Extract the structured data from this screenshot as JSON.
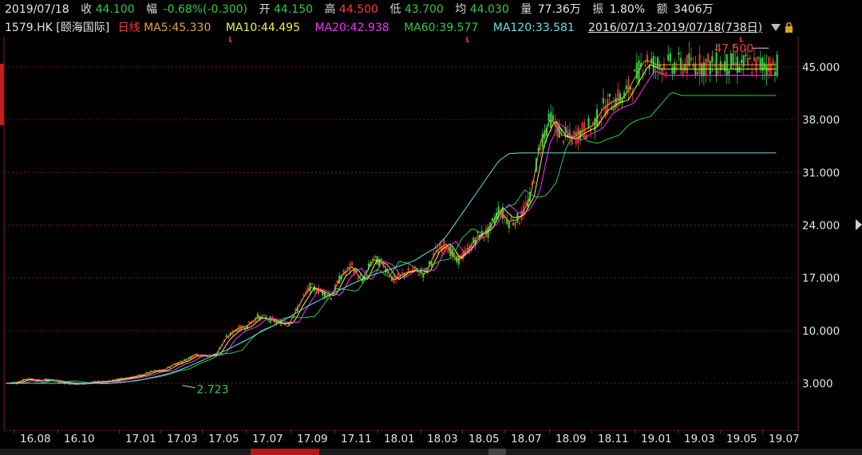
{
  "quote": {
    "date": "2019/07/18",
    "close_label": "收",
    "close": "44.100",
    "change_label": "幅",
    "change": "-0.68%(-0.300)",
    "open_label": "开",
    "open": "44.150",
    "high_label": "高",
    "high": "44.500",
    "low_label": "低",
    "low": "43.700",
    "avg_label": "均",
    "avg": "44.030",
    "volume_label": "量",
    "volume": "77.36万",
    "amplitude_label": "振",
    "amplitude": "1.80%",
    "amount_label": "额",
    "amount": "3406万"
  },
  "info": {
    "code": "1579.HK [颐海国际]",
    "period": "日线",
    "ma5": "MA5:45.330",
    "ma10": "MA10:44.495",
    "ma20": "MA20:42.938",
    "ma60": "MA60:39.577",
    "ma120": "MA120:33.581",
    "range": "2016/07/13-2019/07/18(738日)"
  },
  "colors": {
    "ma5": "#e8a23a",
    "ma10": "#f2f24a",
    "ma20": "#ff2bff",
    "ma60": "#2ecc40",
    "ma120": "#5fe3ea",
    "up": "#ff3b30",
    "down": "#2ecc40",
    "grid": "#7a1a1a"
  },
  "chart_data": {
    "type": "line",
    "title": "1579.HK 颐海国际 日线",
    "ylim": [
      0,
      49
    ],
    "y_ticks": [
      "45.000",
      "38.000",
      "31.000",
      "24.000",
      "17.000",
      "10.000",
      "3.000"
    ],
    "x_ticks": [
      "16.08",
      "16.10",
      "17.01",
      "17.03",
      "17.05",
      "17.07",
      "17.09",
      "17.11",
      "18.01",
      "18.03",
      "18.05",
      "18.07",
      "18.09",
      "18.11",
      "19.01",
      "19.03",
      "19.05",
      "19.07"
    ],
    "annotations": [
      {
        "text": "47.500",
        "type": "max"
      },
      {
        "text": "2.723",
        "type": "min"
      }
    ],
    "x": [
      0,
      10,
      20,
      30,
      40,
      50,
      60,
      70,
      80,
      90,
      100,
      110,
      120,
      130,
      140,
      150,
      160,
      170,
      180,
      190,
      200,
      210,
      220,
      230,
      240,
      250,
      260,
      270,
      280,
      290,
      300,
      310,
      320,
      330,
      340,
      350,
      360,
      370,
      380,
      390,
      400,
      410,
      420,
      430,
      440,
      450,
      460,
      470,
      480,
      490,
      500,
      510,
      520,
      530,
      540,
      550,
      560,
      570,
      580,
      590,
      600,
      610,
      620,
      630,
      640,
      650,
      660,
      670,
      680,
      690,
      700,
      710,
      720,
      730,
      737
    ],
    "series": [
      {
        "name": "MA5",
        "values": [
          3.0,
          3.1,
          3.6,
          3.3,
          3.5,
          3.2,
          3.0,
          2.9,
          3.1,
          3.2,
          3.3,
          3.6,
          3.8,
          4.1,
          4.6,
          4.7,
          5.5,
          6.0,
          6.8,
          6.6,
          6.8,
          9.0,
          10.2,
          10.6,
          11.8,
          11.6,
          11.0,
          10.9,
          13.5,
          15.8,
          15.2,
          14.5,
          17.3,
          18.5,
          16.5,
          19.5,
          18.8,
          16.6,
          17.6,
          18.0,
          17.5,
          20.5,
          21.5,
          19.2,
          20.5,
          22.5,
          23.0,
          26.0,
          24.5,
          24.8,
          27.5,
          35.0,
          38.2,
          36.0,
          35.5,
          36.5,
          37.2,
          39.5,
          40.5,
          41.0,
          43.5,
          46.0,
          45.3,
          45.3,
          45.3,
          45.3,
          45.3,
          45.3,
          45.3,
          45.3,
          45.3,
          45.3,
          45.3,
          45.3,
          45.3
        ]
      },
      {
        "name": "MA120",
        "values": [
          3.0,
          3.0,
          3.0,
          3.0,
          3.0,
          3.0,
          3.0,
          3.0,
          3.0,
          3.0,
          3.0,
          3.1,
          3.3,
          3.5,
          3.8,
          4.1,
          4.5,
          5.0,
          5.6,
          6.2,
          6.8,
          7.4,
          8.1,
          8.8,
          9.6,
          10.3,
          11.0,
          11.8,
          12.6,
          13.4,
          14.1,
          14.8,
          15.5,
          16.2,
          16.8,
          17.4,
          17.8,
          18.3,
          18.8,
          19.3,
          20.2,
          21.0,
          22.5,
          24.5,
          26.5,
          28.5,
          30.5,
          32.5,
          33.5,
          33.58,
          33.58,
          33.58,
          33.58,
          33.58,
          33.58,
          33.58,
          33.58,
          33.58,
          33.58,
          33.58,
          33.58,
          33.58,
          33.58,
          33.58,
          33.58,
          33.58,
          33.58,
          33.58,
          33.58,
          33.58,
          33.58,
          33.58,
          33.58,
          33.58,
          33.58
        ]
      }
    ]
  }
}
